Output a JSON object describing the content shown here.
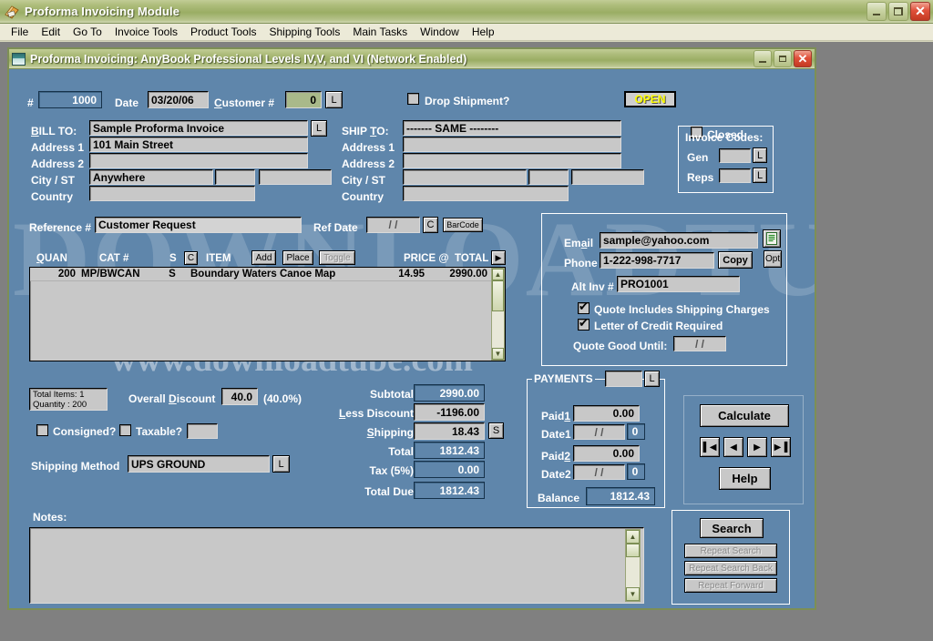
{
  "app": {
    "title": "Proforma Invoicing Module",
    "icon": "invoice-module-icon",
    "window_buttons": {
      "minimize": "–",
      "restore": "❐",
      "close": "✕"
    }
  },
  "menubar": [
    "File",
    "Edit",
    "Go To",
    "Invoice Tools",
    "Product Tools",
    "Shipping Tools",
    "Main Tasks",
    "Window",
    "Help"
  ],
  "child_window": {
    "title": "Proforma Invoicing: AnyBook Professional Levels IV,V, and VI (Network Enabled)",
    "icon": "document-window-icon"
  },
  "header": {
    "number_label": "#",
    "number_value": "1000",
    "date_label": "Date",
    "date_value": "03/20/06",
    "customer_label": "Customer #",
    "customer_value": "0",
    "customer_lookup": "L",
    "drop_shipment_label": "Drop Shipment?",
    "drop_shipment_checked": false,
    "status_badge": "OPEN",
    "closed_label": "Closed",
    "closed_checked": false
  },
  "bill_to": {
    "title": "BILL TO:",
    "lookup": "L",
    "rows": [
      {
        "label": "BILL TO:",
        "value": "Sample Proforma Invoice"
      },
      {
        "label": "Address 1",
        "value": "101 Main Street"
      },
      {
        "label": "Address 2",
        "value": ""
      },
      {
        "label": "City / ST",
        "value": "Anywhere"
      },
      {
        "label": "Country",
        "value": ""
      }
    ],
    "city_state": "",
    "city_zip": ""
  },
  "ship_to": {
    "rows": [
      {
        "label": "SHIP TO:",
        "value": "------- SAME --------"
      },
      {
        "label": "Address 1",
        "value": ""
      },
      {
        "label": "Address 2",
        "value": ""
      },
      {
        "label": "City / ST",
        "value": ""
      },
      {
        "label": "Country",
        "value": ""
      }
    ]
  },
  "invoice_codes": {
    "title": "Invoice Codes:",
    "rows": [
      {
        "label": "Gen",
        "value": "",
        "lookup": "L"
      },
      {
        "label": "Reps",
        "value": "",
        "lookup": "L"
      }
    ]
  },
  "reference": {
    "ref_label": "Reference #",
    "ref_value": "Customer Request",
    "refdate_label": "Ref Date",
    "refdate_value": "/      /",
    "calendar_button": "C",
    "barcode_button": "BarCode"
  },
  "grid": {
    "columns": [
      "QUAN",
      "CAT #",
      "S",
      "C",
      "ITEM",
      "PRICE @",
      "TOTAL"
    ],
    "col_c_button": "C",
    "buttons": {
      "add": "Add",
      "place": "Place",
      "toggle": "Toggle",
      "expand": "▶"
    },
    "rows": [
      {
        "quan": "200",
        "cat": "MP/BWCAN",
        "s": "S",
        "item": "Boundary Waters Canoe Map",
        "price": "14.95",
        "total": "2990.00"
      }
    ]
  },
  "contact": {
    "email_label": "Email",
    "email_value": "sample@yahoo.com",
    "email_doc_button": "document-icon",
    "opt_button": "Opt",
    "phone_label": "Phone",
    "phone_value": "1-222-998-7717",
    "copy_button": "Copy",
    "altinv_label": "Alt Inv #",
    "altinv_value": "PRO1001",
    "quote_shipping_label": "Quote Includes Shipping Charges",
    "quote_shipping_checked": true,
    "letter_credit_label": "Letter of Credit Required",
    "letter_credit_checked": true,
    "quote_good_label": "Quote Good Until:",
    "quote_good_value": "/      /"
  },
  "summary": {
    "total_items_line1": "Total Items: 1",
    "total_items_line2": "Quantity : 200",
    "discount_label": "Overall Discount",
    "discount_value": "40.0",
    "discount_pct": "(40.0%)",
    "consigned_label": "Consigned?",
    "consigned_checked": false,
    "taxable_label": "Taxable?",
    "taxable_checked": false,
    "taxable_code": "",
    "shipping_method_label": "Shipping Method",
    "shipping_method_value": "UPS GROUND",
    "shipping_method_lookup": "L"
  },
  "totals": {
    "rows": [
      {
        "label": "Subtotal",
        "value": "2990.00",
        "style": "ro-blue"
      },
      {
        "label": "Less Discount",
        "value": "-1196.00",
        "style": "edit"
      },
      {
        "label": "Shipping",
        "value": "18.43",
        "style": "edit"
      },
      {
        "label": "Total",
        "value": "1812.43",
        "style": "ro-blue"
      },
      {
        "label": "Tax (5%)",
        "value": "0.00",
        "style": "ro-blue"
      },
      {
        "label": "Total Due",
        "value": "1812.43",
        "style": "ro-blue"
      }
    ],
    "shipping_s_button": "S"
  },
  "payments": {
    "title": "PAYMENTS",
    "code_value": "",
    "code_lookup": "L",
    "rows": [
      {
        "label": "Paid1",
        "value": "0.00"
      },
      {
        "label": "Date1",
        "value": "/      /",
        "num": "0"
      },
      {
        "label": "Paid2",
        "value": "0.00"
      },
      {
        "label": "Date2",
        "value": "/      /",
        "num": "0"
      }
    ],
    "balance_label": "Balance",
    "balance_value": "1812.43"
  },
  "actions": {
    "calculate": "Calculate",
    "nav_first": "▌◀",
    "nav_prev": "◀",
    "nav_next": "▶",
    "nav_last": "▶▐",
    "help": "Help"
  },
  "search": {
    "search": "Search",
    "repeat_search": "Repeat Search",
    "repeat_search_back": "Repeat Search Back",
    "repeat_forward": "Repeat Forward"
  },
  "notes": {
    "label": "Notes:",
    "value": ""
  },
  "watermark": {
    "big": "DOWNLOADTUBE",
    "small": "www.downloadtube.com"
  },
  "colors": {
    "form_blue": "#5f86ab",
    "olive_title": "#9aad64",
    "field_gray": "#c8c8c8",
    "badge_yellow": "#ffff00",
    "desktop_gray": "#808080"
  }
}
